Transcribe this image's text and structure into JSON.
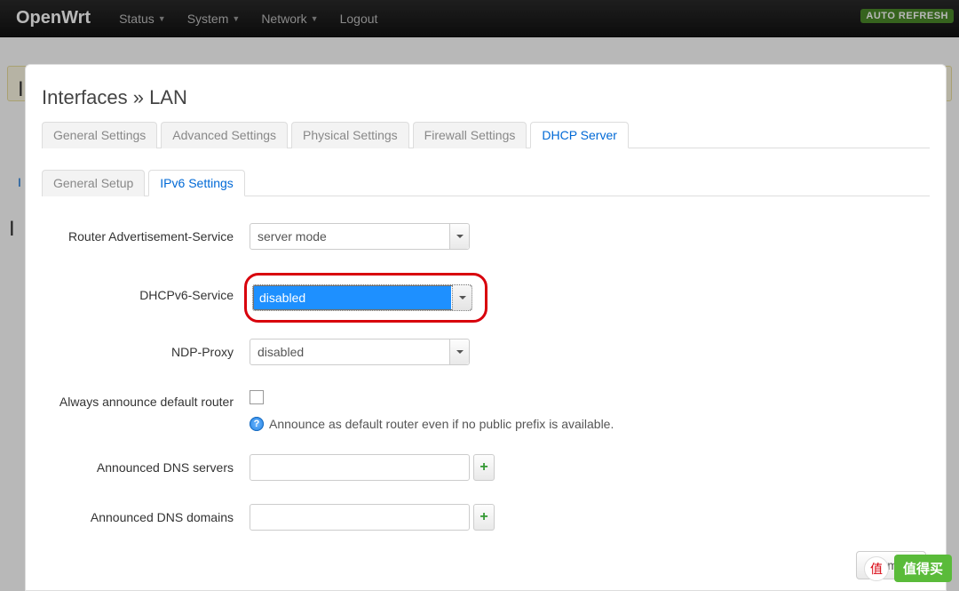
{
  "navbar": {
    "brand": "OpenWrt",
    "items": [
      "Status",
      "System",
      "Network",
      "Logout"
    ],
    "autorefresh": "AUTO REFRESH"
  },
  "modal": {
    "title": "Interfaces » LAN",
    "main_tabs": [
      "General Settings",
      "Advanced Settings",
      "Physical Settings",
      "Firewall Settings",
      "DHCP Server"
    ],
    "main_active": 4,
    "sub_tabs": [
      "General Setup",
      "IPv6 Settings"
    ],
    "sub_active": 1
  },
  "form": {
    "ra_label": "Router Advertisement-Service",
    "ra_value": "server mode",
    "dhcpv6_label": "DHCPv6-Service",
    "dhcpv6_value": "disabled",
    "ndp_label": "NDP-Proxy",
    "ndp_value": "disabled",
    "announce_label": "Always announce default router",
    "announce_hint": "Announce as default router even if no public prefix is available.",
    "dns_servers_label": "Announced DNS servers",
    "dns_domains_label": "Announced DNS domains"
  },
  "footer": {
    "dismiss": "Dismiss"
  },
  "watermark": {
    "text": "值得买"
  }
}
